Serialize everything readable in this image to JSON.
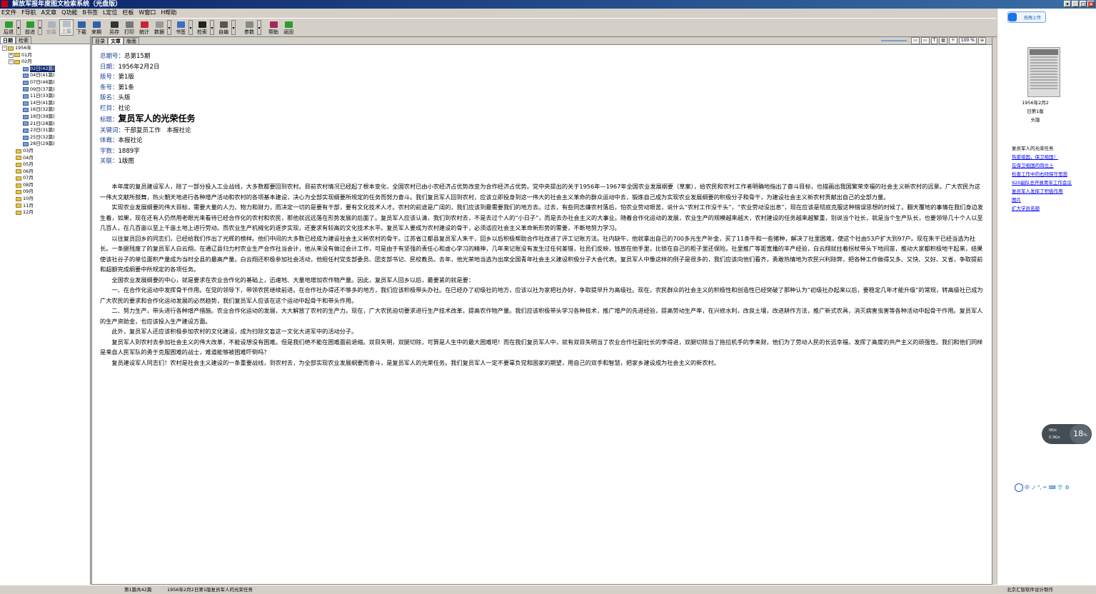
{
  "window": {
    "title": "解放军报年度图文检索系统（光盘版）"
  },
  "menu": [
    "E文件",
    "F导航",
    "A文章",
    "Q功能",
    "B书签",
    "L定位",
    "栏板",
    "W窗口",
    "H帮助"
  ],
  "toolbar": {
    "back": "后退",
    "forward": "前进",
    "prev_article": "前篇",
    "next_article": "上篇",
    "download": "下载",
    "fetch": "来期",
    "save_as": "另存",
    "print": "打印",
    "stats": "统计",
    "data": "数据",
    "bookmark": "书签",
    "search": "检索",
    "self_edit": "自编",
    "params": "参数",
    "help": "帮助",
    "return": "返回"
  },
  "left_tabs": {
    "directory": "日期",
    "search": "检索"
  },
  "tree": {
    "year": "1956年",
    "jan": "01月",
    "feb": "02月",
    "days": [
      "02日(42篇)",
      "04日(41篇)",
      "07日(46篇)",
      "09日(37篇)",
      "11日(33篇)",
      "14日(41篇)",
      "16日(32篇)",
      "18日(39篇)",
      "21日(28篇)",
      "23日(31篇)",
      "25日(32篇)",
      "28日(29篇)"
    ],
    "months": [
      "03月",
      "04月",
      "05月",
      "06月",
      "07月",
      "08月",
      "09月",
      "10月",
      "11月",
      "12月"
    ]
  },
  "main_tabs": {
    "catalog": "目录",
    "article": "文章",
    "layout": "版面"
  },
  "zoom": {
    "level": "100 %"
  },
  "meta": {
    "issue_label": "总期号：",
    "issue": "总第15期",
    "date_label": "日期：",
    "date": "1956年2月2日",
    "page_label": "版号：",
    "page": "第1版",
    "item_label": "条号：",
    "item": "第1条",
    "layout_label": "版名：",
    "layout": "头版",
    "column_label": "栏目：",
    "column": "社论",
    "title_label": "标题：",
    "title": "复员军人的光荣任务",
    "keywords_label": "关键词：",
    "keywords": "干部复员工作　本报社论",
    "genre_label": "体裁：",
    "genre": "本报社论",
    "words_label": "字数：",
    "words": "1889字",
    "related_label": "关联：",
    "related": "1版图"
  },
  "article": {
    "body": "　　本年度的复员建设军人，除了一部分投入工业战线，大多数都要回到农村。目前农村情况已经起了根本变化，全国农村已由小农经济占优势改变为合作经济占优势。党中央提出的关于1956年—1967年全国农业发展纲要（草案），给农民和农村工作者明确地指出了奋斗目标，也描画出我国繁荣幸福的社会主义新农村的远景。广大农民为这一伟大文献所鼓舞，热火朝天地进行各种增产活动和农村的各项基本建设，决心为全部实现纲要所规定的任务而努力奋斗。我们复员军人回到农村，应该立即投身到这一伟大的社会主义革命的群众运动中去，锻炼自己成为实现农业发展纲要的积极分子和骨干，为建设社会主义新农村贡献出自己的全部力量。\n　　实现农业发展纲要的伟大目标，需要大量的人力、物力和财力，而决定一切的是要有干部，要有文化技术人才。农村的前途是广阔的，我们应该到最需要我们的地方去。过去，有些同志嫌农村落后，怕农业劳动艰苦，说什么“农村工作没干头”，“农业劳动没出息”，现在应该是彻底克服这种错误思想的时候了。翻天覆地的事情在我们身边发生着，如果，现在还有人仍然用老眼光来看待已经合作化的农村和农民，那他就远远落在形势发展的后面了。复员军人应该认清，我们到农村去，不是去过个人的“小日子”，而是去办社会主义的大事业。随着合作化运动的发展，农业生产的规模越来越大，农村建设的任务越来越繁重，别说当个社长，就是当个生产队长，也要领导几十个人以至几百人，在几百亩以至上千亩土地上进行劳动。而农业生产机械化的逐步实现，还要求有较高的文化技术水平。复员军人要成为农村建设的骨干，必须适应社会主义革命新形势的需要，不断地努力学习。\n　　以往复员回乡的同志们，已经给我们作出了光辉的榜样。他们中间的大多数已经成为建设社会主义新农村的骨干。江苏省江都县复员军人朱干，回乡以后积极帮助合作社改进了评工记账方法。社内缺牛，他就拿出自己的700多元生产补金，买了11条牛和一些猪种，解决了社里困难，使这个社由53户扩大到97户。现在朱干已经当选为社长。一条腿残废了的复员军人白云翔，在通辽县归力村农业生产合作社当会计，他从来没有做过会计工作，可是由于有坚强的责任心和虚心学习的精神，几年来记账没有发生过任何差错，社员们反映，钱放在他手里，比锁在自己的柜子里还保险。社里推广等距宽播的丰产经验，白云翔就拄着拐杖带头下地间苗，推动大家都积极地干起来，结果使该社谷子的单位面积产量成为当时全县的最高产量。白云翔还积极参加社会活动，他担任村党支部委员、团支部书记、民校教员。去年，他光荣地当选为出席全国青年社会主义建设积极分子大会代表。复员军人中像这样的例子是很多的，我们应该向他们看齐，勇敢热情地为农民兴利除弊，把各种工作做得又多、又快、又好、又省，争取提前和超额完成纲要中所规定的各项任务。\n　　全国农业发展纲要的中心，就是要求在农业合作化的基础上，迅速地、大量地增加农作物产量。因此，复员军人回乡以后，最要紧的就是要：\n　　一、在合作化运动中发挥骨干作用。在党的领导下，带领农民继续前进。在合作社办得还不够多的地方，我们应该积极带头办社。在已经办了初级社的地方，应该以社为家把社办好，争取提早升为高级社。现在，农民群众的社会主义的积极性和创造性已经突破了那种认为“初级社办起来以后，要稳定几年才能升级”的常规，转高级社已成为广大农民的要求和合作化运动发展的必然趋势，我们复员军人应该在这个运动中起骨干和带头作用。\n　　二、努力生产，带头进行各种增产措施。农业合作化运动的发展，大大解放了农村的生产力。现在，广大农民迫切要求进行生产技术改革，提高农作物产量。我们应该积极带头学习各种技术，推广增产的先进经验，提高劳动生产率，在兴修水利，改良土壤，改进耕作方法，推广新式农具，消灭病害虫害等各种活动中起骨干作用。复员军人的生产资助金，也应该投入生产建设方面。\n　　此外，复员军人还应该积极参加农村的文化建设，成为扫除文盲这一文化大进军中的活动分子。\n　　复员军人到农村去参加社会主义的伟大改革，不能设想没有困难。但是我们绝不能在困难面前退缩。双目失明，双腿切除，可算是人生中的最大困难吧！而在我们复员军人中，就有双目失明当了农业合作社副社长的李得进，双腿切除当了拖拉机手的李来财，他们为了劳动人民的长远幸福，发挥了高度的共产主义的顽强性。我们和他们同样是来自人民军队的勇于克服困难的战士，难道能够被困难吓倒吗？\n　　复员建设军人同志们！农村是社会主义建设的一条重要战线，到农村去，为全部实现农业发展纲要而奋斗，是复员军人的光荣任务。我们复员军人一定不要辜负党和国家的期望，用自己的双手和智慧，把家乡建设成为社会主义的新农村。"
  },
  "right_panel": {
    "upload_button": "拖拽上传",
    "thumb_date": "1956年2月2",
    "thumb_page": "日第1版",
    "thumb_layout": "头版",
    "current_title": "复员军人的光荣任务",
    "related_links": [
      "热爱祖国，保卫祖国！",
      "在保卫祖国的岗位上",
      "检查工作中的右倾保守思想",
      "920副队总开展青年工作会议",
      "复员军人发挥了积极作用",
      "图片",
      "扩大学员名额"
    ]
  },
  "speed_widget": {
    "percent": "18",
    "unit": "%",
    "up": "0K/s",
    "down": "0.3K/s"
  },
  "ime": [
    "中",
    "ノ",
    "°,",
    "✂",
    "⌨",
    "👕",
    "⚙"
  ],
  "status": {
    "position": "第1篇共42篇",
    "current": "1956年2月2日第1版复员军人的光荣任务",
    "maker": "北京汇智软件设计制作"
  }
}
